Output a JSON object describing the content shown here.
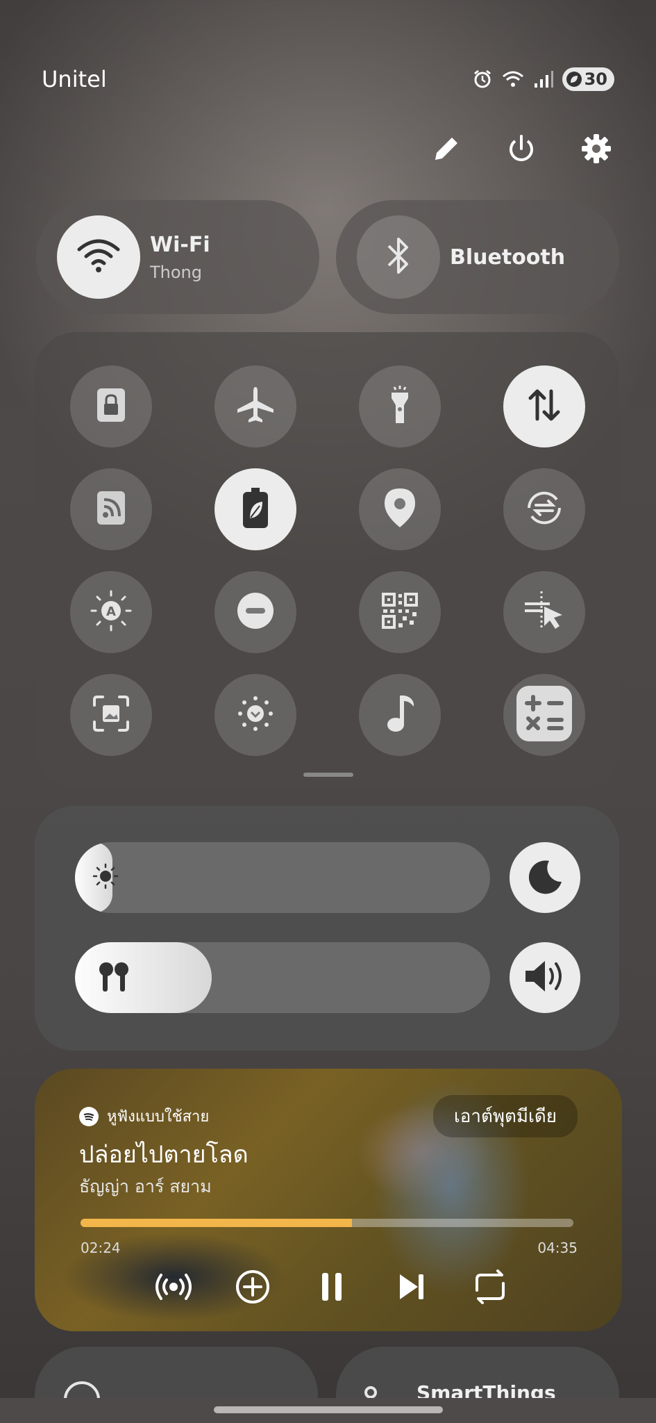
{
  "status_bar": {
    "carrier": "Unitel",
    "battery": "30",
    "icons": [
      "alarm-icon",
      "wifi-icon",
      "signal-icon",
      "battery-icon"
    ]
  },
  "top_actions": [
    "edit-icon",
    "power-icon",
    "settings-icon"
  ],
  "wifi": {
    "label": "Wi-Fi",
    "network": "Thong",
    "on": true
  },
  "bluetooth": {
    "label": "Bluetooth",
    "on": false
  },
  "quick_tiles": [
    {
      "name": "secure-folder",
      "icon": "lock-icon",
      "on": false
    },
    {
      "name": "airplane-mode",
      "icon": "airplane-icon",
      "on": false
    },
    {
      "name": "flashlight",
      "icon": "flashlight-icon",
      "on": false
    },
    {
      "name": "mobile-data",
      "icon": "data-arrows-icon",
      "on": true
    },
    {
      "name": "nfc",
      "icon": "nfc-icon",
      "on": false
    },
    {
      "name": "power-saving",
      "icon": "battery-leaf-icon",
      "on": true
    },
    {
      "name": "location",
      "icon": "location-icon",
      "on": false
    },
    {
      "name": "sync",
      "icon": "sync-icon",
      "on": false
    },
    {
      "name": "auto-brightness",
      "icon": "auto-brightness-icon",
      "on": false
    },
    {
      "name": "do-not-disturb",
      "icon": "minus-circle-icon",
      "on": false
    },
    {
      "name": "qr-scanner",
      "icon": "qr-icon",
      "on": false
    },
    {
      "name": "interaction-control",
      "icon": "cursor-icon",
      "on": false
    },
    {
      "name": "screen-capture",
      "icon": "screenshot-icon",
      "on": false
    },
    {
      "name": "eye-comfort",
      "icon": "eye-comfort-icon",
      "on": false
    },
    {
      "name": "music-share",
      "icon": "music-note-icon",
      "on": false
    },
    {
      "name": "calculator",
      "icon": "calculator-icon",
      "on": false
    }
  ],
  "brightness": {
    "level": 0.09,
    "icon": "sun-icon",
    "mode_icon": "moon-icon"
  },
  "volume": {
    "level": 0.33,
    "icon": "earbuds-icon",
    "button_icon": "speaker-icon"
  },
  "media": {
    "app_label": "หูฟังแบบใช้สาย",
    "output_button": "เอาต์พุตมีเดีย",
    "title": "ปล่อยไปตายโลด",
    "artist": "ธัญญ่า อาร์ สยาม",
    "elapsed": "02:24",
    "duration": "04:35",
    "progress": 0.55,
    "accent": "#f2b64a"
  },
  "bottom": {
    "right_label": "SmartThings"
  }
}
